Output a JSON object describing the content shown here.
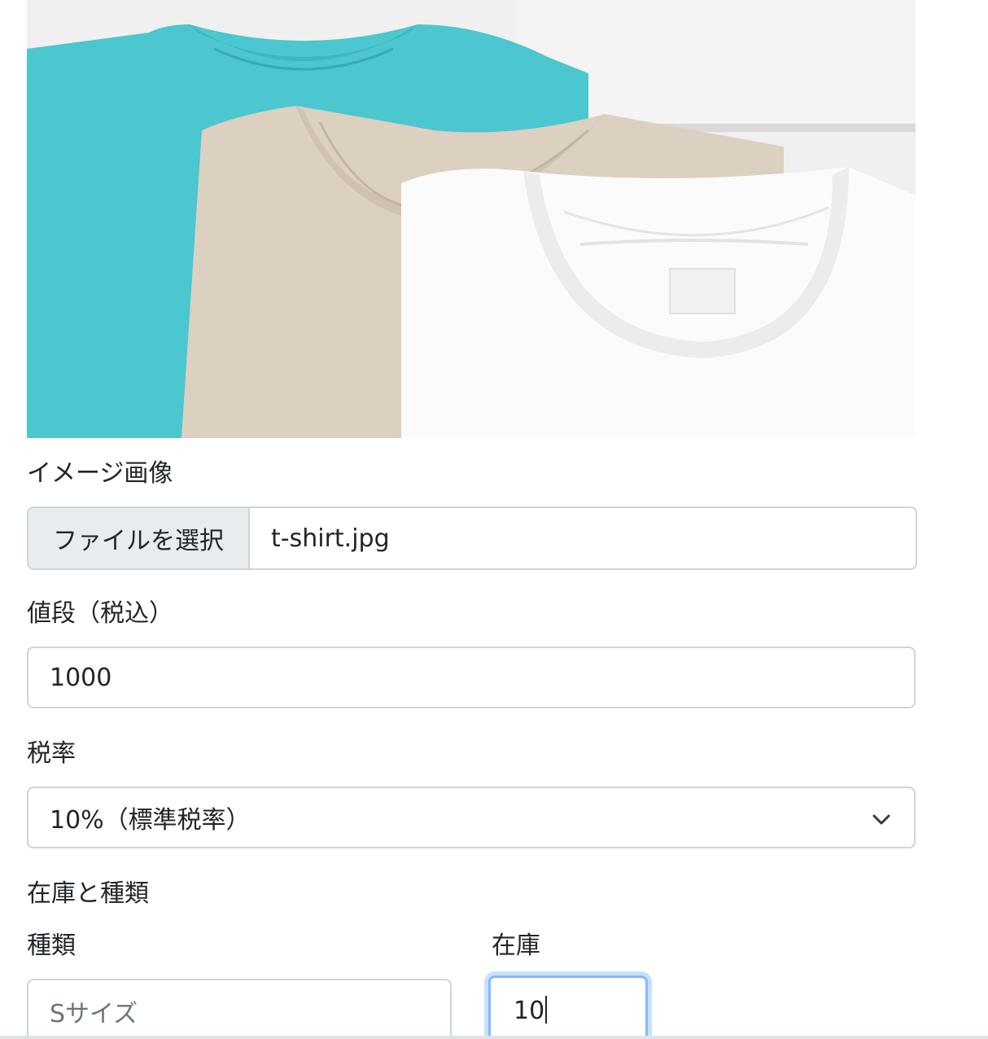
{
  "product_image": {
    "description_icon": "t-shirts-photo",
    "colors": {
      "turquoise": "#4cc6cf",
      "beige": "#dcd0c1",
      "white": "#f8f8f8"
    }
  },
  "image_section": {
    "label": "イメージ画像",
    "file_button_label": "ファイルを選択",
    "file_name": "t-shirt.jpg"
  },
  "price_section": {
    "label": "値段（税込）",
    "value": "1000"
  },
  "tax_section": {
    "label": "税率",
    "selected": "10%（標準税率）"
  },
  "stock_section": {
    "heading": "在庫と種類",
    "type_label": "種類",
    "type_placeholder": "Sサイズ",
    "stock_label": "在庫",
    "stock_value": "10"
  },
  "colors": {
    "border": "#ced4da",
    "focus_border": "#86b7fe",
    "button_bg": "#e9ecef",
    "text": "#212529",
    "placeholder": "#6c757d"
  }
}
